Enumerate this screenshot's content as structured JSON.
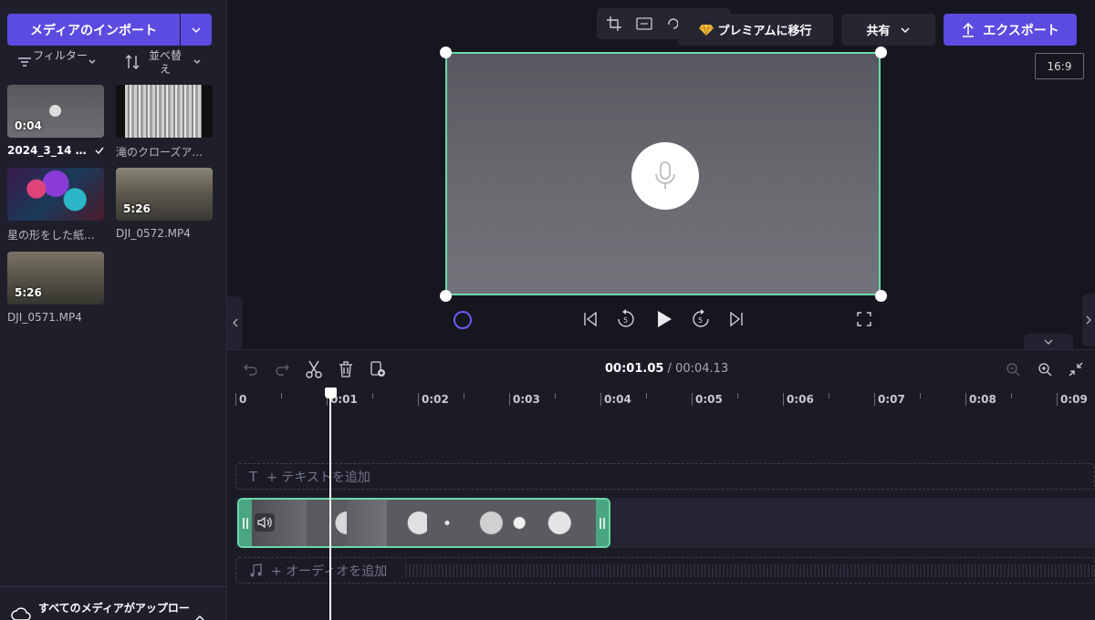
{
  "left_panel": {
    "import_label": "メディアのインポート",
    "filter_label": "フィルター",
    "sort_label": "並べ替え",
    "media": [
      {
        "name": "2024_3_14 1_...",
        "duration": "0:04",
        "active": true
      },
      {
        "name": "滝のクローズア...",
        "duration": ""
      },
      {
        "name": "星の形をした紙...",
        "duration": ""
      },
      {
        "name": "DJI_0572.MP4",
        "duration": "5:26"
      },
      {
        "name": "DJI_0571.MP4",
        "duration": "5:26"
      }
    ],
    "upload_status": "すべてのメディアがアップロー"
  },
  "header": {
    "premium_label": "プレミアムに移行",
    "share_label": "共有",
    "export_label": "エクスポート",
    "aspect_ratio": "16:9"
  },
  "timeline": {
    "current_time": "00:01.05",
    "separator": " / ",
    "total_time": "00:04.13",
    "ruler_labels": [
      "0",
      "0:01",
      "0:02",
      "0:03",
      "0:04",
      "0:05",
      "0:06",
      "0:07",
      "0:08",
      "0:09"
    ],
    "add_text_label": "+ テキストを追加",
    "add_audio_label": "+ オーディオを追加"
  },
  "colors": {
    "accent": "#5b4be0",
    "selection": "#6cd8a8",
    "clip_grip": "#4aa582"
  }
}
